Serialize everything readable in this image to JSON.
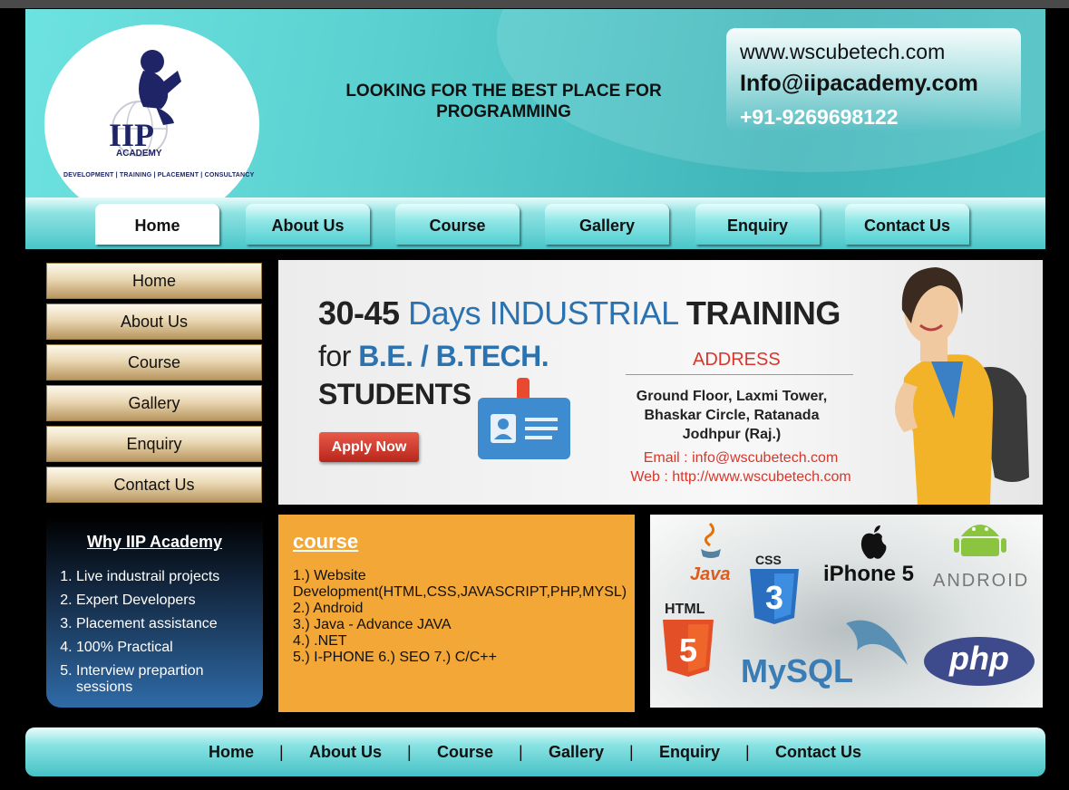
{
  "header": {
    "logo": {
      "main": "IIP",
      "sub": "ACADEMY",
      "tag": "DEVELOPMENT | TRAINING | PLACEMENT | CONSULTANCY"
    },
    "tagline": "LOOKING FOR THE BEST PLACE FOR PROGRAMMING",
    "contact": {
      "website": "www.wscubetech.com",
      "email": "Info@iipacademy.com",
      "phone": "+91-9269698122"
    }
  },
  "nav": [
    "Home",
    "About Us",
    "Course",
    "Gallery",
    "Enquiry",
    "Contact Us"
  ],
  "sidebar": [
    "Home",
    "About Us",
    "Course",
    "Gallery",
    "Enquiry",
    "Contact Us"
  ],
  "banner": {
    "line1_a": "30-45",
    "line1_b": "Days INDUSTRIAL",
    "line1_c": "TRAINING",
    "line2_a": "for",
    "line2_b": "B.E. / B.TECH.",
    "line3": "STUDENTS",
    "apply": "Apply Now",
    "address_heading": "ADDRESS",
    "address_lines": [
      "Ground Floor, Laxmi Tower,",
      "Bhaskar Circle, Ratanada",
      "Jodhpur (Raj.)"
    ],
    "email": "Email : info@wscubetech.com",
    "web": "Web : http://www.wscubetech.com"
  },
  "why": {
    "title": "Why IIP Academy",
    "items": [
      "Live industrail projects",
      "Expert Developers",
      "Placement assistance",
      "100% Practical",
      "Interview prepartion sessions"
    ]
  },
  "course": {
    "title": "course",
    "lines": [
      "1.) Website Development(HTML,CSS,JAVASCRIPT,PHP,MYSL)",
      "2.) Android",
      "3.) Java - Advance JAVA",
      "4.) .NET",
      "5.) I-PHONE 6.) SEO 7.) C/C++"
    ]
  },
  "tech": {
    "java": "Java",
    "css": "CSS",
    "iphone": "iPhone 5",
    "android": "ANDROID",
    "html": "HTML",
    "mysql": "MySQL",
    "php": "php"
  },
  "footer": {
    "links": [
      "Home",
      "About Us",
      "Course",
      "Gallery",
      "Enquiry",
      "Contact Us"
    ],
    "separator": "|"
  },
  "colors": {
    "teal": "#4ac6c9",
    "orange": "#f2a737",
    "navy": "#1e2466",
    "red": "#d9362a",
    "blue": "#2a72b0"
  }
}
